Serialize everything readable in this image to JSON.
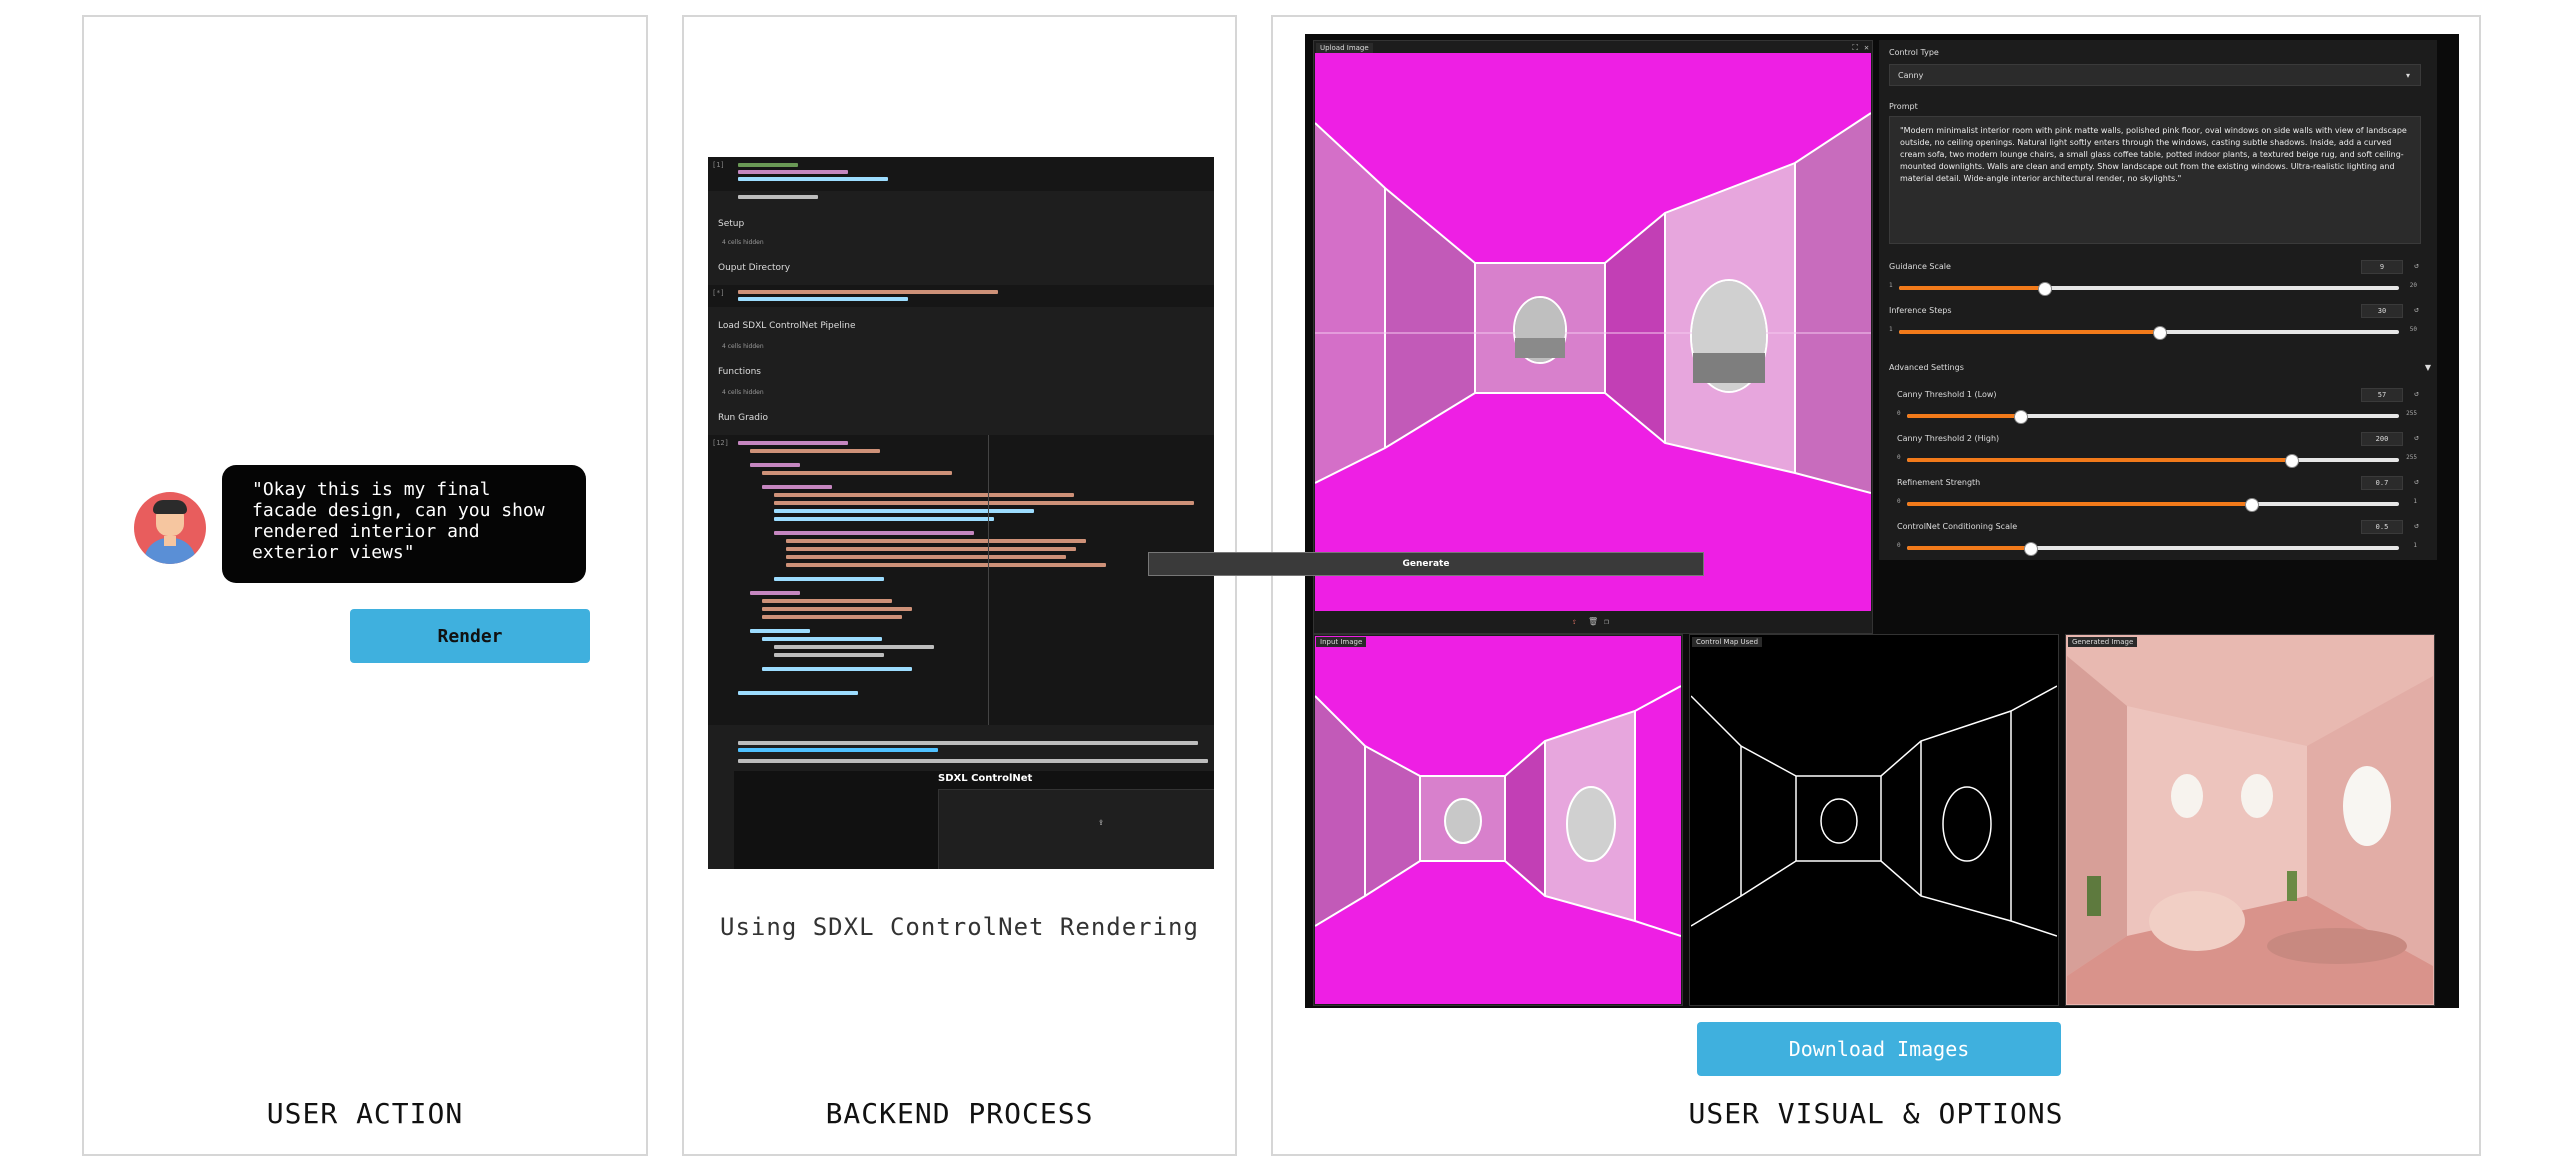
{
  "panels": {
    "user_action": {
      "caption": "USER ACTION",
      "bubble_text": "\"Okay this is my final facade design, can you show rendered interior and exterior views\"",
      "render_label": "Render"
    },
    "backend": {
      "caption": "BACKEND PROCESS",
      "subtitle": "Using SDXL ControlNet Rendering",
      "notebook": {
        "sections": [
          "Setup",
          "Ouput Directory",
          "Load SDXL ControlNet Pipeline",
          "Functions",
          "Run Gradio"
        ],
        "hidden_note": "4 cells hidden",
        "gradio_title": "SDXL ControlNet"
      }
    },
    "visual": {
      "caption": "USER VISUAL & OPTIONS",
      "download_label": "Download Images",
      "app": {
        "upload_label": "Upload Image",
        "control_type_label": "Control Type",
        "control_type_value": "Canny",
        "prompt_label": "Prompt",
        "prompt_text": "\"Modern minimalist interior room with pink matte walls, polished pink floor, oval windows on side walls with view of landscape outside, no ceiling openings. Natural light softly enters through the windows, casting subtle shadows. Inside, add a curved cream sofa, two modern lounge chairs, a small glass coffee table, potted indoor plants, a textured beige rug, and soft ceiling-mounted downlights. Walls are clean and empty. Show landscape out from the existing windows.  Ultra-realistic lighting and material detail. Wide-angle interior architectural render, no skylights.\"",
        "sliders": [
          {
            "label": "Guidance Scale",
            "value": "9",
            "min": "1",
            "max": "20",
            "frac": 0.29
          },
          {
            "label": "Inference Steps",
            "value": "30",
            "min": "1",
            "max": "50",
            "frac": 0.52
          }
        ],
        "advanced_label": "Advanced Settings",
        "advanced_sliders": [
          {
            "label": "Canny Threshold 1 (Low)",
            "value": "57",
            "min": "0",
            "max": "255",
            "frac": 0.23
          },
          {
            "label": "Canny Threshold 2 (High)",
            "value": "200",
            "min": "0",
            "max": "255",
            "frac": 0.78
          },
          {
            "label": "Refinement Strength",
            "value": "0.7",
            "min": "0",
            "max": "1",
            "frac": 0.7
          },
          {
            "label": "ControlNet Conditioning Scale",
            "value": "0.5",
            "min": "0",
            "max": "1",
            "frac": 0.25
          }
        ],
        "generate_label": "Generate",
        "outputs": [
          {
            "label": "Input Image"
          },
          {
            "label": "Control Map Used"
          },
          {
            "label": "Generated Image"
          }
        ]
      }
    }
  },
  "colors": {
    "accent_blue": "#3fb0de",
    "magenta": "#ee1fe4",
    "slider_orange": "#f27a1a"
  }
}
